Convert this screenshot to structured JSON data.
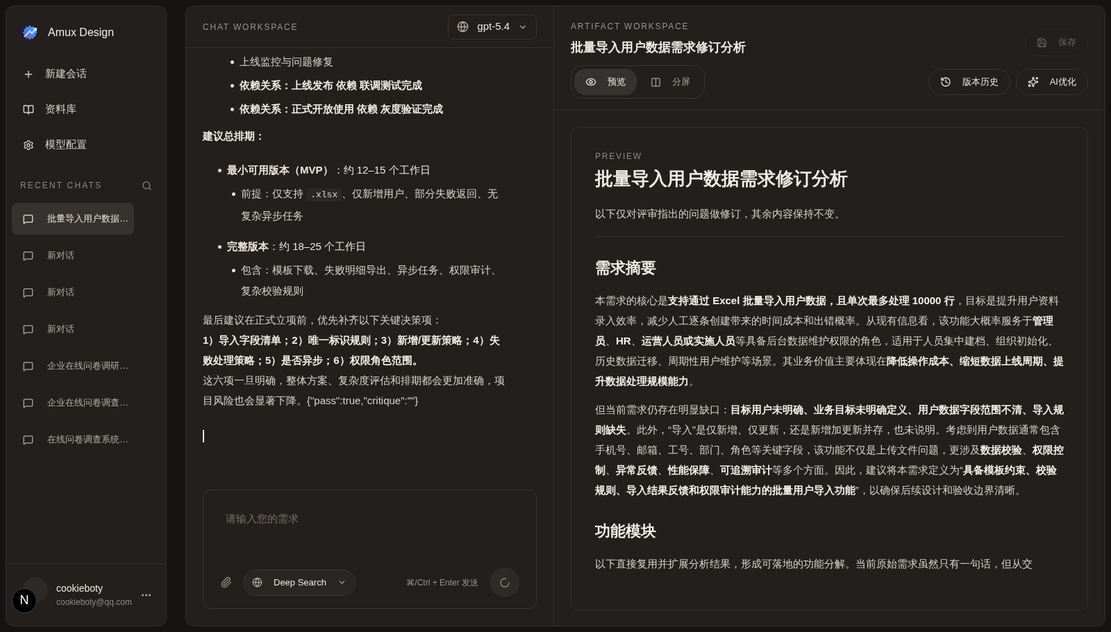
{
  "sidebar": {
    "brand": "Amux Design",
    "nav": [
      {
        "kind": "new",
        "label": "新建会话"
      },
      {
        "kind": "library",
        "label": "资料库"
      },
      {
        "kind": "settings",
        "label": "模型配置"
      }
    ],
    "recent_title": "RECENT CHATS",
    "chats": [
      {
        "title": "批量导入用户数据…",
        "selected": true
      },
      {
        "title": "新对话",
        "selected": false
      },
      {
        "title": "新对话",
        "selected": false
      },
      {
        "title": "新对话",
        "selected": false
      },
      {
        "title": "企业在线问卷调研…",
        "selected": false
      },
      {
        "title": "企业在线问卷调查…",
        "selected": false
      },
      {
        "title": "在线问卷调查系统…",
        "selected": false
      }
    ],
    "user": {
      "name": "cookieboty",
      "email": "cookieboty@qq.com",
      "badge": "N"
    }
  },
  "chat": {
    "header": "CHAT WORKSPACE",
    "model": "gpt-5.4",
    "blocks": [
      {
        "kind": "nested_list",
        "items": [
          {
            "text": "上线监控与问题修复",
            "bold": false
          },
          {
            "text": "依赖关系：上线发布 依赖 联调测试完成",
            "bold": true
          },
          {
            "text": "依赖关系：正式开放使用 依赖 灰度验证完成",
            "bold": true
          }
        ]
      },
      {
        "kind": "paragraph",
        "text": "建议总排期：",
        "bold": true
      },
      {
        "kind": "list",
        "items": [
          {
            "text": "**最小可用版本（MVP）**：约 12–15 个工作日",
            "children": [
              {
                "text": "前提：仅支持 ",
                "code": ".xlsx",
                "after": "、仅新增用户、部分失败返回、无复杂异步任务"
              }
            ]
          },
          {
            "text": "**完整版本**：约 18–25 个工作日",
            "children": [
              {
                "text": "包含：模板下载、失败明细导出、异步任务、权限审计、复杂校验规则"
              }
            ]
          }
        ]
      },
      {
        "kind": "paragraph_group",
        "lines": [
          {
            "text": "最后建议在正式立项前，优先补齐以下关键决策项：",
            "bold": false
          },
          {
            "text": "1）导入字段清单；2）唯一标识规则；3）新增/更新策略；4）失败处理策略；5）是否异步；6）权限角色范围。",
            "bold": true
          },
          {
            "text": "这六项一旦明确，整体方案、复杂度评估和排期都会更加准确，项目风险也会显著下降。{\"pass\":true,\"critique\":\"\"}",
            "bold": false
          }
        ]
      },
      {
        "kind": "cursor"
      }
    ],
    "input": {
      "placeholder": "请输入您的需求",
      "mode": "Deep Search",
      "hint": "⌘/Ctrl + Enter 发送"
    }
  },
  "artifact": {
    "header": "ARTIFACT WORKSPACE",
    "title": "批量导入用户数据需求修订分析",
    "save": {
      "label": "保存",
      "disabled": true
    },
    "tabs": [
      {
        "kind": "preview",
        "label": "预览",
        "selected": true
      },
      {
        "kind": "split",
        "label": "分屏",
        "selected": false
      }
    ],
    "actions": [
      {
        "kind": "history",
        "label": "版本历史"
      },
      {
        "kind": "ai",
        "label": "AI优化"
      }
    ],
    "preview": {
      "eyebrow": "PREVIEW",
      "title": "批量导入用户数据需求修订分析",
      "intro": "以下仅对评审指出的问题做修订，其余内容保持不变。",
      "sections": [
        {
          "heading": "需求摘要",
          "paragraphs": [
            "本需求的核心是**支持通过 Excel 批量导入用户数据，且单次最多处理 10000 行**，目标是提升用户资料录入效率，减少人工逐条创建带来的时间成本和出错概率。从现有信息看，该功能大概率服务于**管理员**、**HR**、**运营人员或实施人员**等具备后台数据维护权限的角色，适用于人员集中建档、组织初始化、历史数据迁移、周期性用户维护等场景。其业务价值主要体现在**降低操作成本、缩短数据上线周期、提升数据处理规模能力**。",
            "但当前需求仍存在明显缺口：**目标用户未明确、业务目标未明确定义、用户数据字段范围不清、导入规则缺失**。此外，“导入”是仅新增、仅更新，还是新增加更新并存，也未说明。考虑到用户数据通常包含手机号、邮箱、工号、部门、角色等关键字段，该功能不仅是上传文件问题，更涉及**数据校验**、**权限控制**、**异常反馈**、**性能保障**、**可追溯审计**等多个方面。因此，建议将本需求定义为“**具备模板约束、校验规则、导入结果反馈和权限审计能力的批量用户导入功能**”，以确保后续设计和验收边界清晰。"
          ]
        },
        {
          "heading": "功能模块",
          "paragraphs": [
            "以下直接复用并扩展分析结果，形成可落地的功能分解。当前原始需求虽然只有一句话，但从交"
          ]
        }
      ]
    }
  }
}
